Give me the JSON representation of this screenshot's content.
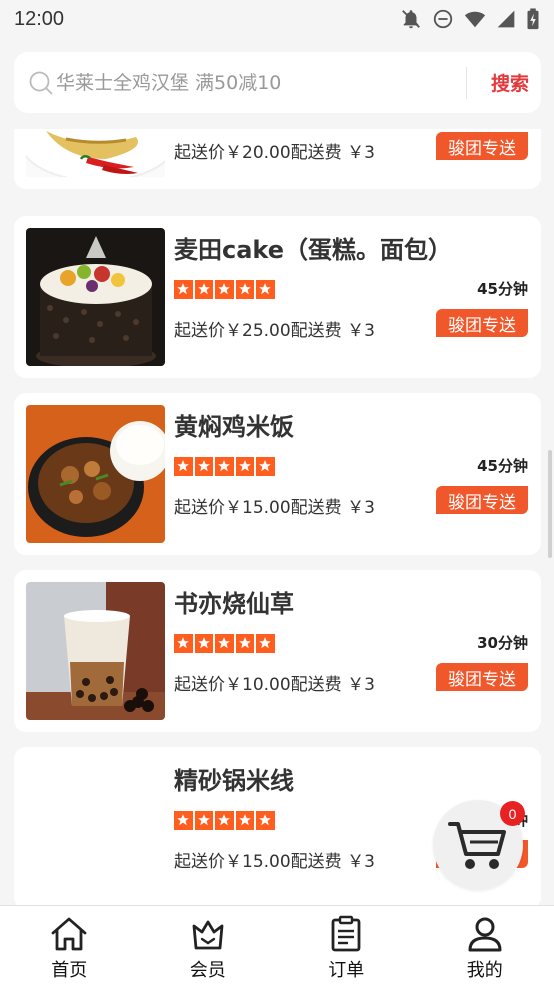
{
  "status_bar": {
    "time": "12:00"
  },
  "search": {
    "placeholder": "华莱士全鸡汉堡 满50减10",
    "button_label": "搜索"
  },
  "shops": [
    {
      "name": "",
      "time": "",
      "fee_text": "起送价￥20.00配送费 ￥3",
      "tag": "骏团专送",
      "image": "peppers-dish"
    },
    {
      "name": "麦田cake（蛋糕。面包）",
      "stars": 5,
      "time": "45分钟",
      "fee_text": "起送价￥25.00配送费 ￥3",
      "tag": "骏团专送",
      "image": "cake"
    },
    {
      "name": "黄焖鸡米饭",
      "stars": 5,
      "time": "45分钟",
      "fee_text": "起送价￥15.00配送费 ￥3",
      "tag": "骏团专送",
      "image": "braised-chicken"
    },
    {
      "name": "书亦烧仙草",
      "stars": 5,
      "time": "30分钟",
      "fee_text": "起送价￥10.00配送费 ￥3",
      "tag": "骏团专送",
      "image": "bubble-tea"
    },
    {
      "name": "精砂锅米线",
      "stars": 5,
      "time": "钟",
      "fee_text": "起送价￥15.00配送费 ￥3",
      "tag": "",
      "image": "none"
    }
  ],
  "cart": {
    "count": "0"
  },
  "bottom_nav": [
    {
      "label": "首页",
      "icon": "home-icon"
    },
    {
      "label": "会员",
      "icon": "member-icon"
    },
    {
      "label": "订单",
      "icon": "order-icon"
    },
    {
      "label": "我的",
      "icon": "profile-icon"
    }
  ],
  "colors": {
    "accent": "#e4393c",
    "tag": "#f0572b",
    "star": "#ff5e1f",
    "badge": "#e82222"
  }
}
